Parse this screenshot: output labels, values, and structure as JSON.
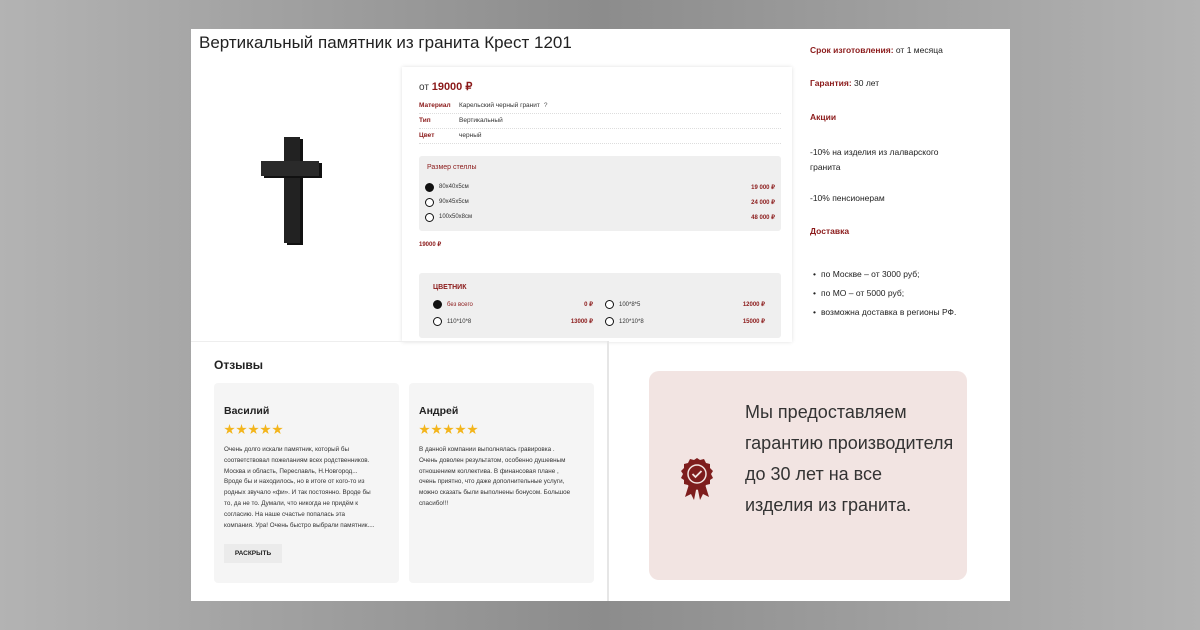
{
  "title": "Вертикальный памятник из гранита Крест 1201",
  "product": {
    "price_prefix": "от",
    "price": "19000 ₽",
    "props": [
      {
        "key": "Материал",
        "value": "Карельский черный гранит",
        "help": "?"
      },
      {
        "key": "Тип",
        "value": "Вертикальный"
      },
      {
        "key": "Цвет",
        "value": "черный"
      }
    ],
    "size_title": "Размер стеллы",
    "sizes": [
      {
        "label": "80x40x5см",
        "price": "19 000 ₽",
        "selected": true
      },
      {
        "label": "90x45x5см",
        "price": "24 000 ₽",
        "selected": false
      },
      {
        "label": "100x50x8см",
        "price": "48 000 ₽",
        "selected": false
      }
    ],
    "subtotal": "19000 ₽",
    "flower_title": "ЦВЕТНИК",
    "flowers": [
      {
        "label": "без всего",
        "price": "0 ₽",
        "selected": true
      },
      {
        "label": "100*8*5",
        "price": "12000 ₽",
        "selected": false
      },
      {
        "label": "110*10*8",
        "price": "13000 ₽",
        "selected": false
      },
      {
        "label": "120*10*8",
        "price": "15000 ₽",
        "selected": false
      }
    ]
  },
  "side": {
    "lead_label": "Срок изготовления:",
    "lead_value": " от 1 месяца",
    "warranty_label": "Гарантия:",
    "warranty_value": " 30 лет",
    "promo_label": "Акции",
    "promo_1": "-10% на изделия из лалварского гранита",
    "promo_2": "-10% пенсионерам",
    "delivery_label": "Доставка",
    "delivery": [
      "по Москве – от 3000 руб;",
      "по МО – от 5000 руб;",
      "возможна доставка в регионы РФ."
    ]
  },
  "reviews": {
    "heading": "Отзывы",
    "items": [
      {
        "name": "Василий",
        "stars": 5,
        "text": "Очень долго искали памятник, который бы\nсоответствовал пожеланиям всех родственников.\nМосква и область, Переславль, Н.Новгород...\nВроде бы и находилось, но в итоге от кого-то из\nродных звучало «фи». И так постоянно. Вроде бы\nто, да не то. Думали, что никогда не придём к\nсогласию. На наше счастье попалась эта\nкомпания. Ура! Очень быстро выбрали памятник...."
      },
      {
        "name": "Андрей",
        "stars": 5,
        "text": "В данной компании выполнялась гравировка .\nОчень доволен результатом, особенно душевным\nотношением коллектива. В финансовая плане ,\nочень приятно, что даже дополнительные услуги,\nможно сказать были выполнены бонусом. Большое\nспасибо!!!"
      }
    ],
    "expand_label": "РАСКРЫТЬ"
  },
  "guarantee": {
    "text": "Мы предоставляем гарантию производителя до 30 лет на все изделия из гранита.",
    "icon": "award-badge-icon"
  },
  "colors": {
    "accent": "#8b1a1a",
    "star": "#f3b51c",
    "guarantee_bg": "#f2e4e2"
  }
}
